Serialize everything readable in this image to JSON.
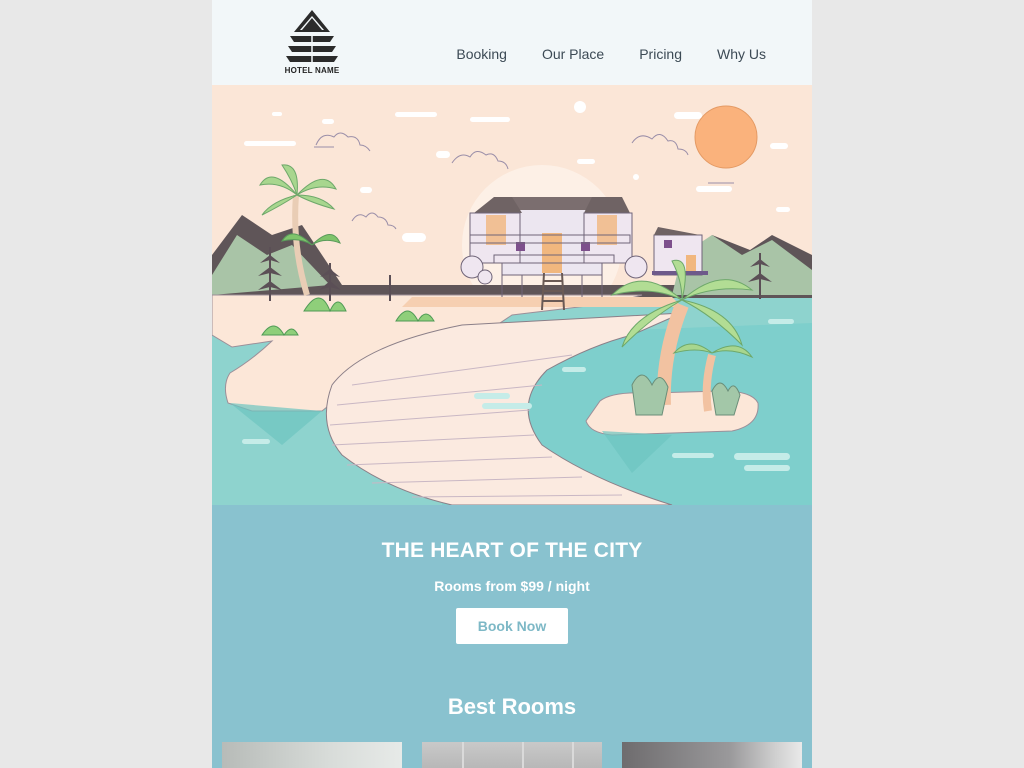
{
  "brand": {
    "logo_text": "HOTEL NAME"
  },
  "nav": {
    "items": [
      {
        "label": "Booking"
      },
      {
        "label": "Our Place"
      },
      {
        "label": "Pricing"
      },
      {
        "label": "Why Us"
      }
    ]
  },
  "promo": {
    "title": "THE HEART OF THE CITY",
    "subtitle": "Rooms from $99 / night",
    "cta_label": "Book Now"
  },
  "rooms": {
    "section_title": "Best Rooms"
  },
  "colors": {
    "page_background": "#e8e8e8",
    "header_background": "#f2f7f9",
    "accent": "#89c2cf",
    "cta_text": "#7db8c6"
  }
}
